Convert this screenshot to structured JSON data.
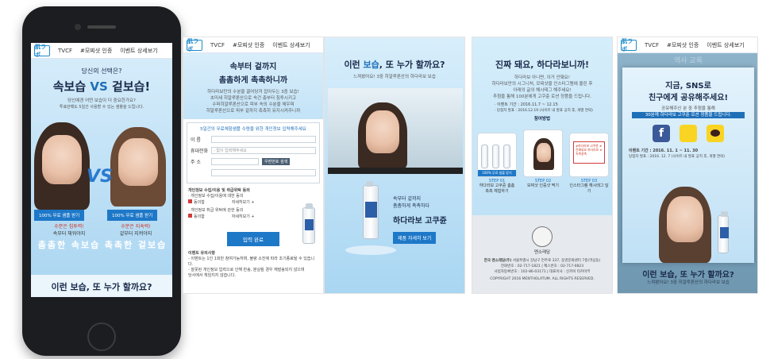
{
  "nav": {
    "logo": "肌ラボ",
    "items": [
      "TVCF",
      "#모찌샷 인증",
      "이벤트 상세보기"
    ]
  },
  "phone": {
    "q": "당신의 선택은?",
    "headline_a": "속보습",
    "headline_vs": "VS",
    "headline_b": "겉보습!",
    "sub": "당신에겐 어떤 보습이 더 중요한가요?",
    "sub2": "투표만해도 5일간 사용할 수 있는 샘플을 드립니다.",
    "vs": "VS",
    "btn_left": "100% 무료 샘플 받기",
    "btn_right": "100% 무료 샘플 받기",
    "left_caption": "수분은 침투력!",
    "left_caption2": "속부터 채워야지",
    "left_big": "촘촘한 속보습",
    "right_caption": "수분은 지속력!",
    "right_caption2": "겉부터 지켜야지",
    "right_big": "촉촉한 겉보습",
    "bottom": "이런 보습, 또 누가 할까요?"
  },
  "p1": {
    "title1": "속부터 겉까지",
    "title2": "촘촘하게 촉촉하니까",
    "desc": "하다라보만의 수분을 끌어당겨 잡아두는 3중 보습!",
    "desc2": "초미세 히알루론산으로 속건 층부터 침투시키고",
    "desc3": "수퍼히알루론산으로 피부 속의 수분을 채우며",
    "desc4": "히알루론산으로 피부 겉까지 촉촉히 유지시켜주니까",
    "form_title": "5일간의 무료체험샘플 수령을 위한 개인정보 입력해주세요",
    "name_label": "이 름",
    "phone_label": "휴대전화",
    "addr_label": "주 소",
    "phone_ph": "- 없이 입력해주세요",
    "zip_btn": "우편번호 검색",
    "agree_title": "개인정보 수집/이용 및 취급위탁 동의",
    "agree1": "· 개인정보 수집/이용에 대한 동의",
    "agree1b": "동의함",
    "detail1": "자세히보기 +",
    "agree2": "· 개인정보 취급 위탁에 관한 동의",
    "agree2b": "동의함",
    "detail2": "자세히보기 +",
    "submit": "입력 완료",
    "notice_title": "이벤트 유의사항",
    "notice1": "- 이벤트는 1인 1회만 참여가능하며, 불량 소진에 따라 조기종료될 수 있습니다.",
    "notice2": "- 잘못된 개인정보 입력으로 인해 반송, 분실될 경우 재발송되지 않으며",
    "notice3": "당사에서 책임지지 않습니다."
  },
  "p2": {
    "title_a": "이런 ",
    "title_b": "보습",
    "title_c": ", 또 누가 할까요?",
    "sub": "느껴봤어요! 3중 히알루론산의 하다라보 보습",
    "caption1": "속부터 겉까지",
    "caption2": "촘촘하게 촉촉하다",
    "brand": "하다라보 고쿠쥰",
    "btn": "제품 자세히 보기"
  },
  "p3": {
    "title": "진짜 돼요, 하다라보니까!",
    "sub1": "하다라보 아니면, 이거 안돼요!",
    "sub2": "하다라보만의 시그니처, 모찌샷을 인스타그램에 올린 후",
    "sub3": "아래의 글의 해시태그 해주세요!",
    "sub4": "추첨을 통해 100분에게 고쿠쥰 로션 정품을 드립니다.",
    "period": "· 이벤트 기간 : 2016.11.7 ~ 12.15",
    "winner": "· 당첨자 발표 : 2016.12.19 (사이트 내 발표 공지 후, 개별 연락)",
    "how": "참여방법",
    "step1": "STEP 01",
    "step1t": "하다라보 고쿠쥰 촘촘 촉촉 체험하기",
    "step2": "STEP 02",
    "step2t": "모찌샷 인증샷 찍기",
    "step3": "STEP 03",
    "step3t": "인스타그램 해시태그 달기",
    "tag_box": "#하다라보 고쿠쥰 #진짜되요 하다라보 #속촉겉촉",
    "mini_btn": "100% 무료 샘플 받기",
    "mentho": "멘소래담",
    "company": "한국 멘소래담(주)",
    "addr": "서울특별시 강남구 언주로 337, 동영문화센터 7층(역삼동)",
    "tel": "전화번호 : 02-717-1821",
    "fax": "팩스번호 : 02-717-0823",
    "biz": "사업자등록번호 : 102-86-03171",
    "ceo": "대표이사 : 신카이 타카아키",
    "copy": "COPYRIGHT 2016 MENTHOLATUM. ALL RIGHTS RESERVED."
  },
  "p4": {
    "title1": "지금, SNS로",
    "title2": "친구에게 공유해주세요!",
    "sub1": "공유해주신 분 중 추첨을 통해",
    "sub2": "30분께 하다라보 고쿠쥰 로션 정품을 드립니다.",
    "period": "이벤트 기간 : 2016. 11. 1 ~ 11. 30",
    "winner": "당첨자 발표 : 2016. 12. 7 (사이트 내 발표 공지 후, 개별 연락)",
    "bottom": "이런 보습, 또 누가 할까요?",
    "bottom_sub": "느껴봤어요! 3중 히알루론산의 하다라보 보습",
    "bg_text": "역사 교육"
  },
  "colors": {
    "accent": "#1e78c8",
    "dark": "#1a2a4a",
    "red": "#d23b3b"
  }
}
